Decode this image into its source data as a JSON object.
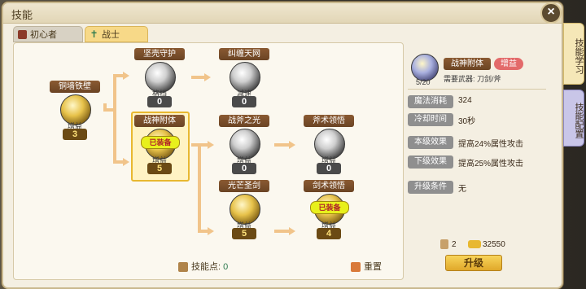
{
  "window": {
    "title": "技能",
    "close": "×"
  },
  "tabs": [
    {
      "label": "初心者"
    },
    {
      "label": "战士",
      "icon": "✝"
    }
  ],
  "side_tabs": [
    {
      "label": "技能学习"
    },
    {
      "label": "技能配置"
    }
  ],
  "skills": {
    "tongqiang": {
      "name": "铜墙铁壁",
      "kind": "增益",
      "level": "3"
    },
    "jianke": {
      "name": "坚壳守护",
      "kind": "格挡",
      "level": "0"
    },
    "jiuchan": {
      "name": "纠缠天网",
      "kind": "减速",
      "level": "0"
    },
    "zhanshen": {
      "name": "战神附体",
      "kind": "增益",
      "level": "5",
      "equipped": "已装备"
    },
    "zhanfu": {
      "name": "战斧之光",
      "kind": "增益",
      "level": "0"
    },
    "fushu": {
      "name": "斧术领悟",
      "kind": "增益",
      "level": "0"
    },
    "guangmang": {
      "name": "光芒圣剑",
      "kind": "增益",
      "level": "5",
      "equipped": "已装备"
    },
    "jianshu": {
      "name": "剑术领悟",
      "kind": "增益",
      "level": "4",
      "equipped": "已装备"
    }
  },
  "footer": {
    "points_label": "技能点:",
    "points_value": "0",
    "reset": "重置"
  },
  "detail": {
    "name": "战神附体",
    "badge": "增益",
    "level": "5/20",
    "weapon": "需要武器: 刀剑/斧",
    "rows": [
      {
        "label": "魔法消耗",
        "value": "324"
      },
      {
        "label": "冷却时间",
        "value": "30秒"
      },
      {
        "label": "本级效果",
        "value": "提高24%属性攻击"
      },
      {
        "label": "下级效果",
        "value": "提高25%属性攻击"
      },
      {
        "label": "升级条件",
        "value": "无"
      }
    ],
    "book_count": "2",
    "gold": "32550",
    "upgrade": "升级"
  }
}
